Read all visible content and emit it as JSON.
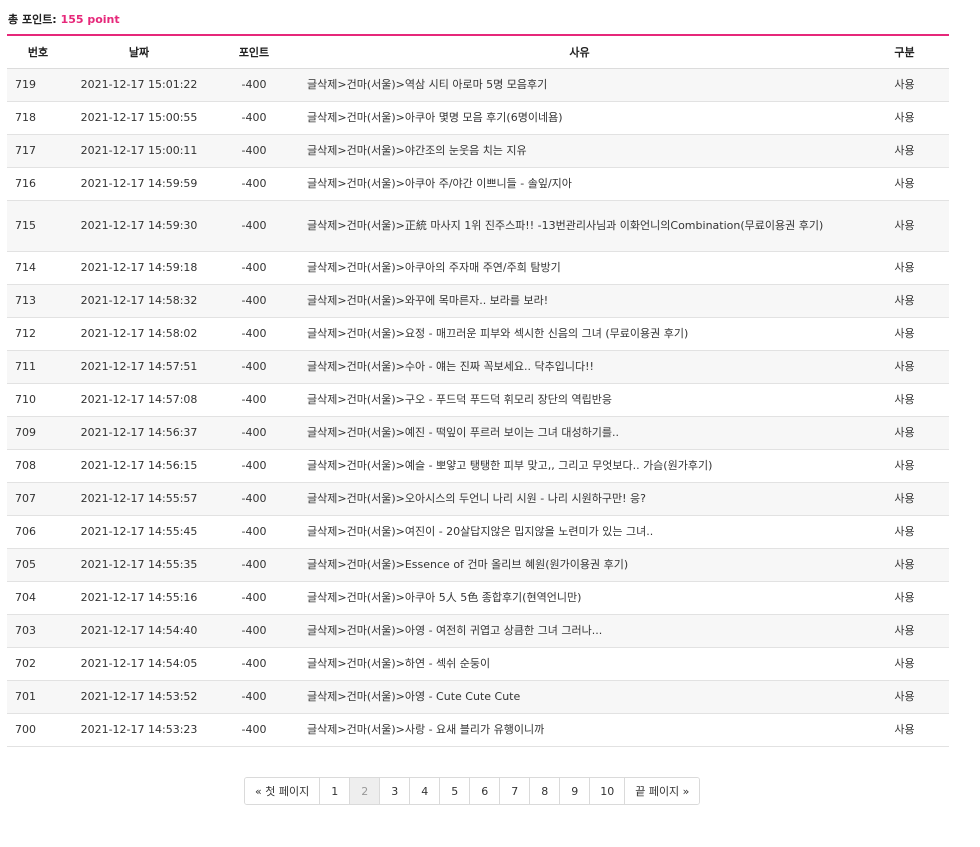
{
  "summary": {
    "label": "총 포인트:",
    "value": "155 point"
  },
  "table": {
    "headers": {
      "no": "번호",
      "date": "날짜",
      "points": "포인트",
      "reason": "사유",
      "type": "구분"
    },
    "rows": [
      {
        "no": "719",
        "date": "2021-12-17 15:01:22",
        "points": "-400",
        "reason": "글삭제>건마(서울)>역삼 시티 아로마 5명 모음후기",
        "type": "사용"
      },
      {
        "no": "718",
        "date": "2021-12-17 15:00:55",
        "points": "-400",
        "reason": "글삭제>건마(서울)>아쿠아 몇명 모음 후기(6명이네욤)",
        "type": "사용"
      },
      {
        "no": "717",
        "date": "2021-12-17 15:00:11",
        "points": "-400",
        "reason": "글삭제>건마(서울)>야간조의 눈웃음 치는 지유",
        "type": "사용"
      },
      {
        "no": "716",
        "date": "2021-12-17 14:59:59",
        "points": "-400",
        "reason": "글삭제>건마(서울)>아쿠아 주/야간 이쁘니들 - 솔잎/지아",
        "type": "사용"
      },
      {
        "no": "715",
        "date": "2021-12-17 14:59:30",
        "points": "-400",
        "reason": "글삭제>건마(서울)>正統 마사지 1위 진주스파!! -13번관리사님과 이화언니의Combination(무료이용권 후기)",
        "type": "사용"
      },
      {
        "no": "714",
        "date": "2021-12-17 14:59:18",
        "points": "-400",
        "reason": "글삭제>건마(서울)>아쿠아의 주자매 주연/주희 탐방기",
        "type": "사용"
      },
      {
        "no": "713",
        "date": "2021-12-17 14:58:32",
        "points": "-400",
        "reason": "글삭제>건마(서울)>와꾸에 목마른자.. 보라를 보라!",
        "type": "사용"
      },
      {
        "no": "712",
        "date": "2021-12-17 14:58:02",
        "points": "-400",
        "reason": "글삭제>건마(서울)>요정 - 매끄러운 피부와 섹시한 신음의 그녀 (무료이용권 후기)",
        "type": "사용"
      },
      {
        "no": "711",
        "date": "2021-12-17 14:57:51",
        "points": "-400",
        "reason": "글삭제>건마(서울)>수아 - 얘는 진짜 꼭보세요.. 닥추입니다!!",
        "type": "사용"
      },
      {
        "no": "710",
        "date": "2021-12-17 14:57:08",
        "points": "-400",
        "reason": "글삭제>건마(서울)>구오 - 푸드덕 푸드덕 휘모리 장단의 역립반응",
        "type": "사용"
      },
      {
        "no": "709",
        "date": "2021-12-17 14:56:37",
        "points": "-400",
        "reason": "글삭제>건마(서울)>예진 - 떡잎이 푸르러 보이는 그녀 대성하기를..",
        "type": "사용"
      },
      {
        "no": "708",
        "date": "2021-12-17 14:56:15",
        "points": "-400",
        "reason": "글삭제>건마(서울)>예슬 - 뽀얗고 탱탱한 피부 맞고,, 그리고 무엇보다.. 가슴(원가후기)",
        "type": "사용"
      },
      {
        "no": "707",
        "date": "2021-12-17 14:55:57",
        "points": "-400",
        "reason": "글삭제>건마(서울)>오아시스의 두언니 나리 시원 - 나리 시원하구만! 응?",
        "type": "사용"
      },
      {
        "no": "706",
        "date": "2021-12-17 14:55:45",
        "points": "-400",
        "reason": "글삭제>건마(서울)>여진이 - 20살답지않은 밉지않을 노련미가 있는 그녀..",
        "type": "사용"
      },
      {
        "no": "705",
        "date": "2021-12-17 14:55:35",
        "points": "-400",
        "reason": "글삭제>건마(서울)>Essence of 건마 올리브 혜원(원가이용권 후기)",
        "type": "사용"
      },
      {
        "no": "704",
        "date": "2021-12-17 14:55:16",
        "points": "-400",
        "reason": "글삭제>건마(서울)>아쿠아 5人 5色 종합후기(현역언니만)",
        "type": "사용"
      },
      {
        "no": "703",
        "date": "2021-12-17 14:54:40",
        "points": "-400",
        "reason": "글삭제>건마(서울)>아영 - 여전히 귀엽고 상큼한 그녀 그러나...",
        "type": "사용"
      },
      {
        "no": "702",
        "date": "2021-12-17 14:54:05",
        "points": "-400",
        "reason": "글삭제>건마(서울)>하연 - 섹쉬 순둥이",
        "type": "사용"
      },
      {
        "no": "701",
        "date": "2021-12-17 14:53:52",
        "points": "-400",
        "reason": "글삭제>건마(서울)>아영 - Cute Cute Cute",
        "type": "사용"
      },
      {
        "no": "700",
        "date": "2021-12-17 14:53:23",
        "points": "-400",
        "reason": "글삭제>건마(서울)>사랑 - 요새 블리가 유행이니까",
        "type": "사용"
      }
    ]
  },
  "pagination": {
    "first": "« 첫 페이지",
    "pages": [
      "1",
      "2",
      "3",
      "4",
      "5",
      "6",
      "7",
      "8",
      "9",
      "10"
    ],
    "current": "2",
    "last": "끝 페이지 »"
  },
  "colors": {
    "accent": "#e6287a",
    "row_alt": "#f7f7f7",
    "border": "#e2e2e2"
  }
}
